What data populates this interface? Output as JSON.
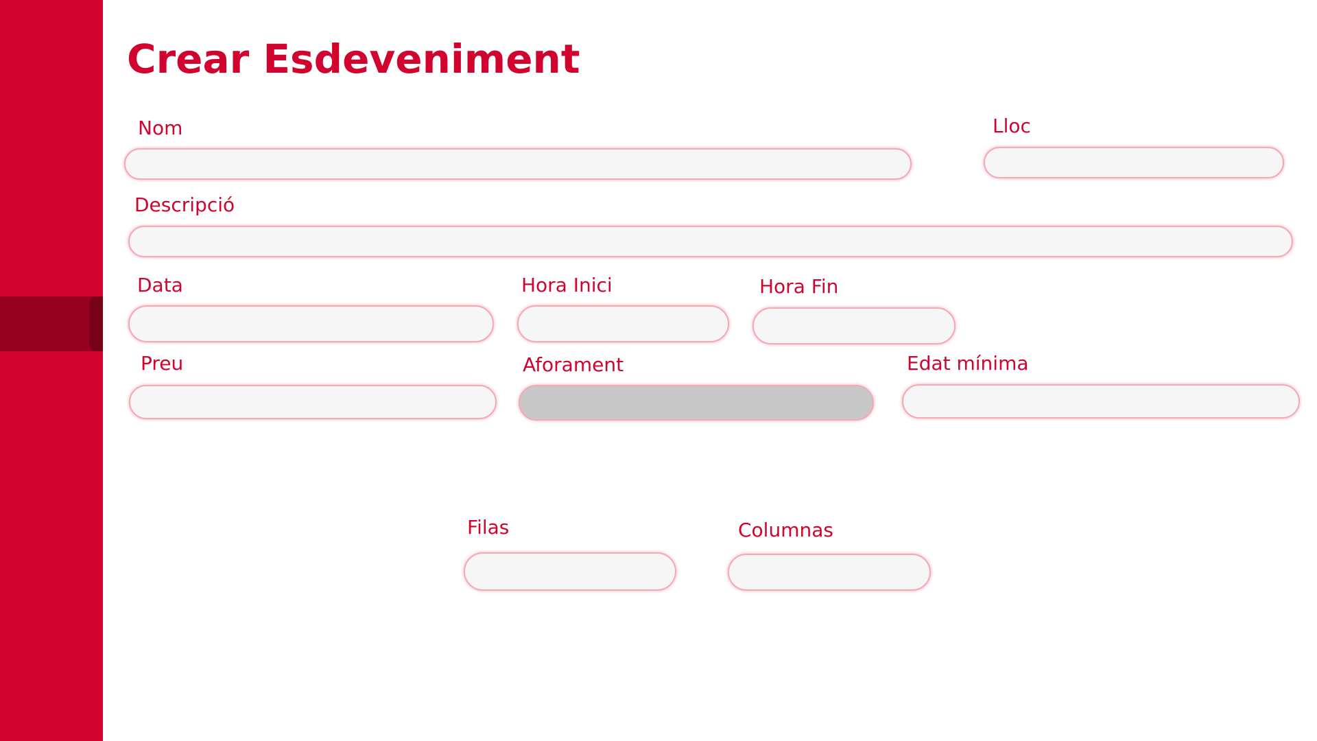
{
  "page": {
    "title": "Crear Esdeveniment"
  },
  "colors": {
    "accent": "#d0042e",
    "sidebar_active": "#980222",
    "field_background": "#f6f6f6",
    "field_disabled": "#c8c8c8",
    "field_border": "#f4a9b7"
  },
  "form": {
    "nom": {
      "label": "Nom",
      "value": ""
    },
    "lloc": {
      "label": "Lloc",
      "value": ""
    },
    "descripcio": {
      "label": "Descripció",
      "value": ""
    },
    "data": {
      "label": "Data",
      "value": ""
    },
    "hora_inici": {
      "label": "Hora Inici",
      "value": ""
    },
    "hora_fin": {
      "label": "Hora Fin",
      "value": ""
    },
    "preu": {
      "label": "Preu",
      "value": ""
    },
    "aforament": {
      "label": "Aforament",
      "value": "",
      "disabled": true
    },
    "edat_minima": {
      "label": "Edat mínima",
      "value": ""
    },
    "filas": {
      "label": "Filas",
      "value": ""
    },
    "columnas": {
      "label": "Columnas",
      "value": ""
    }
  }
}
